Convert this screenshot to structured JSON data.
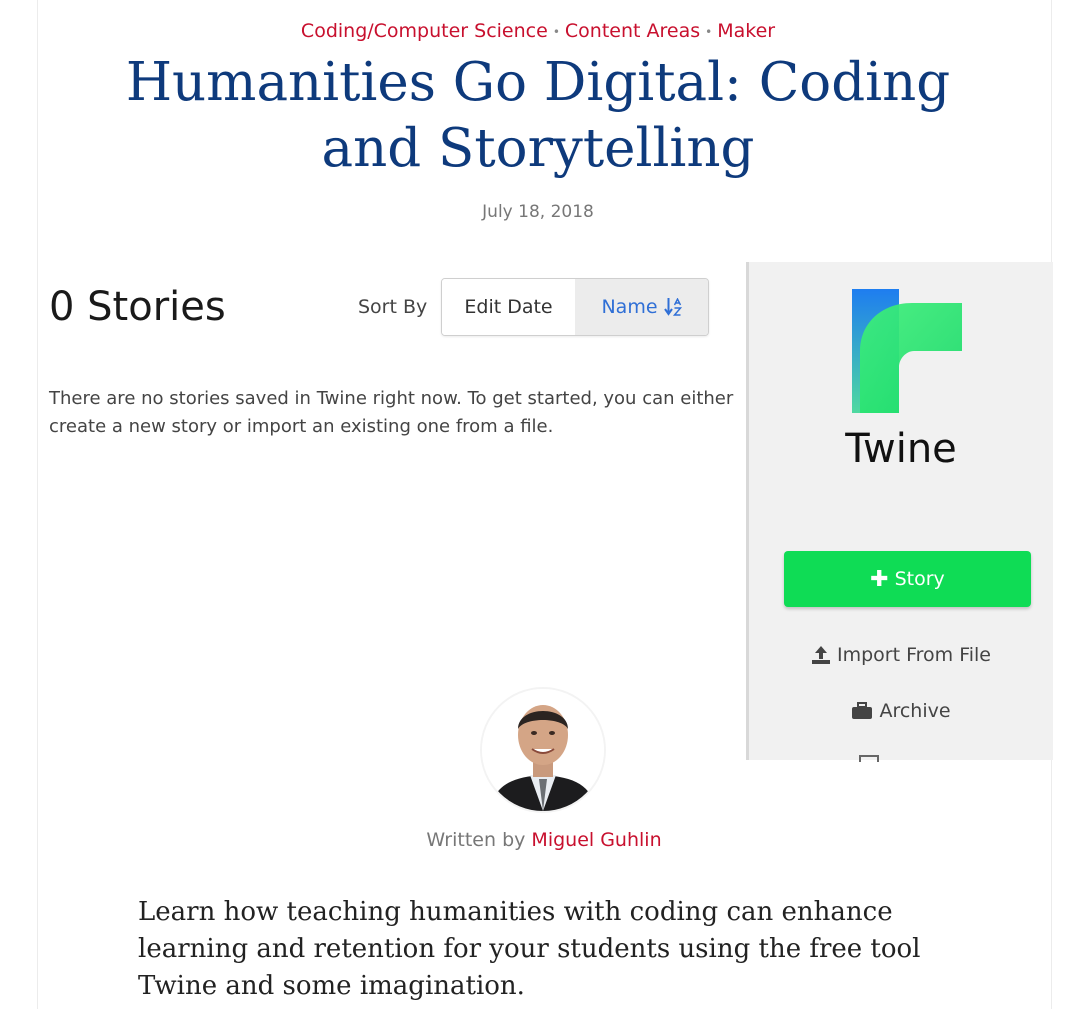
{
  "article": {
    "categories": [
      "Coding/Computer Science",
      "Content Areas",
      "Maker"
    ],
    "category_separator": "•",
    "title": "Humanities Go Digital: Coding and Storytelling",
    "date": "July 18, 2018",
    "byline_prefix": "Written by",
    "author": "Miguel Guhlin",
    "lede": "Learn how teaching humanities with coding can enhance learning and retention for your students using the free tool Twine and some imagination."
  },
  "twine_screenshot": {
    "stories_heading": "0 Stories",
    "sort_label": "Sort By",
    "sort_options": [
      "Edit Date",
      "Name"
    ],
    "sort_active": "Name",
    "empty_message": "There are no stories saved in Twine right now. To get started, you can either create a new story or import an existing one from a file.",
    "brand_name": "Twine",
    "story_button": "Story",
    "import_link": "Import From File",
    "archive_link": "Archive"
  },
  "colors": {
    "category_red": "#c8102e",
    "title_blue": "#0e3a7c",
    "twine_green": "#0fdc55",
    "sort_active_blue": "#2f6fd6"
  },
  "icons": [
    "plus-icon",
    "upload-icon",
    "briefcase-icon",
    "sort-alpha-icon",
    "twine-logo"
  ]
}
